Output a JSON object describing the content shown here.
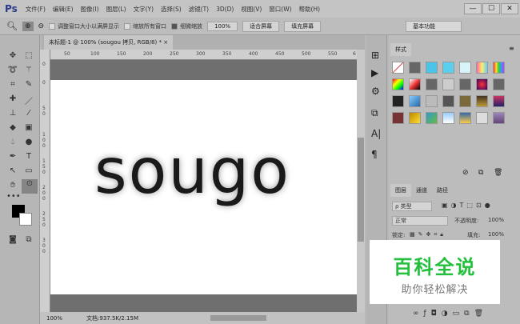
{
  "app": {
    "logo": "Ps"
  },
  "menu": [
    "文件(F)",
    "编辑(E)",
    "图像(I)",
    "图层(L)",
    "文字(Y)",
    "选择(S)",
    "滤镜(T)",
    "3D(D)",
    "视图(V)",
    "窗口(W)",
    "帮助(H)"
  ],
  "window": {
    "minimize": "—",
    "maximize": "☐",
    "close": "✕"
  },
  "options": {
    "resize_windows": "调整窗口大小以满屏显示",
    "zoom_all": "缩放所有窗口",
    "scrubby_zoom": "细微缩放",
    "zoom_pct": "100%",
    "fit_screen": "适合屏幕",
    "fill_screen": "填充屏幕",
    "workspace": "基本功能"
  },
  "document": {
    "tab_title": "未标题-1 @ 100% (sougou 拷贝, RGB/8) *",
    "close": "×",
    "text": "sougo"
  },
  "ruler": {
    "h": [
      "50",
      "100",
      "150",
      "200",
      "250",
      "300",
      "350",
      "400",
      "450",
      "500",
      "550",
      "6"
    ],
    "v": [
      "0",
      "0",
      "50",
      "100",
      "150",
      "200",
      "250",
      "300"
    ]
  },
  "status": {
    "zoom": "100%",
    "doc": "文档:937.5K/2.15M"
  },
  "styles_panel": {
    "tab": "样式"
  },
  "layers_panel": {
    "tabs": [
      "图层",
      "通道",
      "路径"
    ],
    "filter": "ρ 类型",
    "blend": "正常",
    "opacity_label": "不透明度:",
    "opacity": "100%",
    "lock_label": "锁定:",
    "fill_label": "填充:",
    "fill": "100%"
  },
  "watermark": {
    "title": "百科全说",
    "subtitle": "助你轻松解决"
  }
}
